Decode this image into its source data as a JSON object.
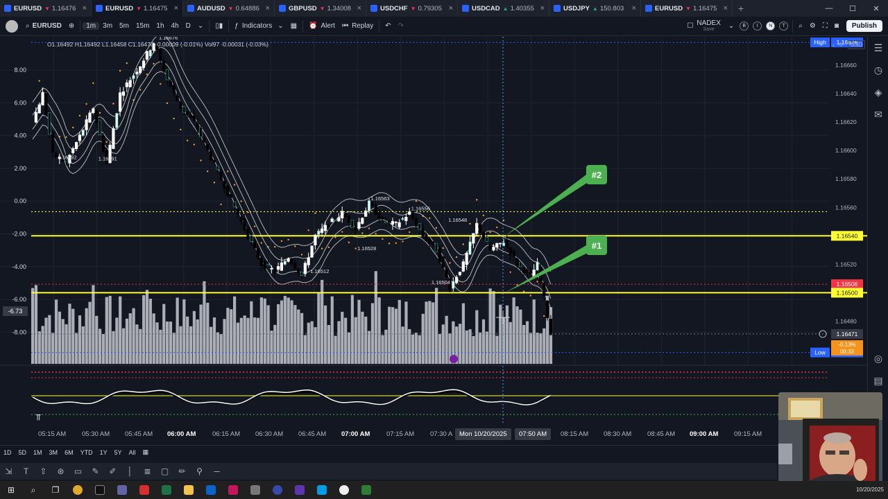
{
  "tabs": [
    {
      "symbol": "EURUSD",
      "arrow": "▼",
      "dir": "down",
      "price": "1.16476",
      "active": false
    },
    {
      "symbol": "EURUSD",
      "arrow": "▼",
      "dir": "down",
      "price": "1.16475",
      "active": true
    },
    {
      "symbol": "AUDUSD",
      "arrow": "▼",
      "dir": "down",
      "price": "0.64886",
      "active": false
    },
    {
      "symbol": "GBPUSD",
      "arrow": "▼",
      "dir": "down",
      "price": "1.34008",
      "active": false
    },
    {
      "symbol": "USDCHF",
      "arrow": "▼",
      "dir": "down",
      "price": "0.79305",
      "active": false
    },
    {
      "symbol": "USDCAD",
      "arrow": "▲",
      "dir": "up",
      "price": "1.40355",
      "active": false
    },
    {
      "symbol": "USDJPY",
      "arrow": "▲",
      "dir": "up",
      "price": "150.803",
      "active": false
    },
    {
      "symbol": "EURUSD",
      "arrow": "▼",
      "dir": "down",
      "price": "1.16475",
      "active": false
    }
  ],
  "toolbar": {
    "symbol": "EURUSD",
    "timeframes": [
      "1m",
      "3m",
      "5m",
      "15m",
      "1h",
      "4h",
      "D"
    ],
    "selected_timeframe": "1m",
    "indicators": "Indicators",
    "alert": "Alert",
    "replay": "Replay",
    "broker": "NADEX",
    "broker_sub": "Save",
    "circles": [
      "B",
      "I",
      "N",
      "T"
    ],
    "publish": "Publish"
  },
  "legend": {
    "text": "O1.16492 H1.16492 L1.16458 C1.16470 -0.00009 (-0.01%) Vol97 -0.00031 (-0.03%)"
  },
  "price_axis": {
    "currency": "USD"
  },
  "chart_data": {
    "type": "candlestick",
    "symbol": "EURUSD",
    "interval": "1m",
    "right_axis": {
      "ticks": [
        "1.16660",
        "1.16640",
        "1.16620",
        "1.16600",
        "1.16580",
        "1.16560",
        "1.16520",
        "1.16480"
      ],
      "ylim": [
        1.1645,
        1.1668
      ]
    },
    "left_axis": {
      "ticks": [
        "8.00",
        "6.00",
        "4.00",
        "2.00",
        "0.00",
        "-2.00",
        "-4.00",
        "-6.00",
        "-8.00"
      ],
      "current": "-6.73"
    },
    "levels": [
      {
        "label": "High",
        "price": "1.16676",
        "color": "#2962ff"
      },
      {
        "label": "",
        "price": "1.16540",
        "color": "#ffff33"
      },
      {
        "label": "",
        "price": "1.16506",
        "color": "#f23645"
      },
      {
        "label": "",
        "price": "1.16500",
        "color": "#ffff33"
      },
      {
        "label": "",
        "price": "1.16471",
        "color": "#363a45"
      },
      {
        "label": "Low",
        "price": "1.16458",
        "color": "#2962ff"
      }
    ],
    "countdown": {
      "change": "-0.13%",
      "time": "00:33"
    },
    "annotations": [
      {
        "text": "1.16676",
        "x": 40,
        "y": 1.16676
      },
      {
        "text": "1.16592",
        "x": 10,
        "y": 1.16592
      },
      {
        "text": "1.16591",
        "x": 22,
        "y": 1.16591
      },
      {
        "text": "1.16563",
        "x": 103,
        "y": 1.16563
      },
      {
        "text": "1.16556",
        "x": 115,
        "y": 1.16556
      },
      {
        "text": "1.16548",
        "x": 126,
        "y": 1.16548
      },
      {
        "text": "1.16528",
        "x": 99,
        "y": 1.16528
      },
      {
        "text": "1.16512",
        "x": 85,
        "y": 1.16512
      },
      {
        "text": "1.16504",
        "x": 121,
        "y": 1.16504
      }
    ],
    "callouts": [
      {
        "text": "#2",
        "target_price": 1.1654
      },
      {
        "text": "#1",
        "target_price": 1.165
      }
    ],
    "time_labels": [
      "05:15 AM",
      "05:30 AM",
      "05:45 AM",
      "06:00 AM",
      "06:15 AM",
      "06:30 AM",
      "06:45 AM",
      "07:00 AM",
      "07:15 AM",
      "07:30 A",
      "08:15 AM",
      "08:30 AM",
      "08:45 AM",
      "09:00 AM",
      "09:15 AM"
    ],
    "bold_time_labels": [
      "06:00 AM",
      "07:00 AM",
      "09:00 AM"
    ],
    "crosshair_date": "Mon 10/20/2025",
    "crosshair_time": "07:50 AM"
  },
  "ranges": [
    "1D",
    "5D",
    "1M",
    "3M",
    "6M",
    "YTD",
    "1Y",
    "5Y",
    "All"
  ],
  "clock": "10/20/2025",
  "colors": {
    "up": "#22ab94",
    "down": "#f23645",
    "level": "#ffff33",
    "callout": "#4caf50",
    "background": "#131722"
  }
}
